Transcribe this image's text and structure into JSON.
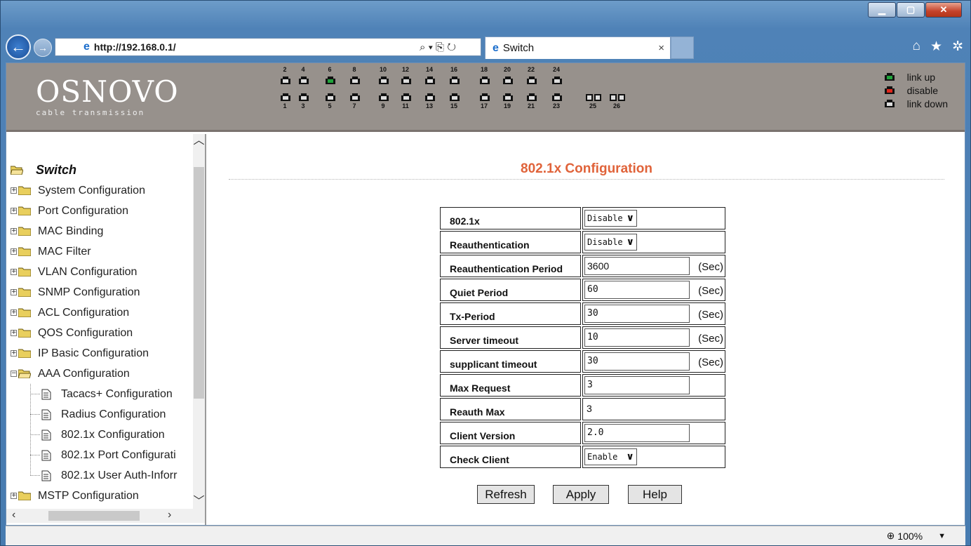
{
  "browser": {
    "url": "http://192.168.0.1/",
    "tab_title": "Switch",
    "tab_close": "×",
    "addr_tools": "⌕ ▾ ⎘ ↻",
    "zoom": "100%"
  },
  "banner": {
    "logo_name": "OSNOVO",
    "logo_tagline": "cable transmission",
    "ports_top": [
      "2",
      "4",
      "6",
      "8",
      "10",
      "12",
      "14",
      "16",
      "18",
      "20",
      "22",
      "24"
    ],
    "ports_bottom": [
      "1",
      "3",
      "5",
      "7",
      "9",
      "11",
      "13",
      "15",
      "17",
      "19",
      "21",
      "23",
      "25",
      "26"
    ],
    "port_6_status": "link up",
    "legend": {
      "link_up": "link up",
      "disable": "disable",
      "link_down": "link down"
    },
    "colors": {
      "link_up": "#1fa33b",
      "disable": "#e0261b",
      "link_down": "#111111"
    }
  },
  "sidebar": {
    "root": "Switch",
    "items": [
      "System Configuration",
      "Port Configuration",
      "MAC Binding",
      "MAC Filter",
      "VLAN Configuration",
      "SNMP Configuration",
      "ACL Configuration",
      "QOS Configuration",
      "IP Basic Configuration",
      "AAA Configuration"
    ],
    "aaa_children": [
      "Tacacs+ Configuration",
      "Radius Configuration",
      "802.1x Configuration",
      "802.1x Port Configurati",
      "802.1x User Auth-Inforr"
    ],
    "after": "MSTP Configuration"
  },
  "main": {
    "title": "802.1x Configuration",
    "title_color": "#e0633a",
    "rows": {
      "dot1x": {
        "label": "802.1x",
        "value": "Disable"
      },
      "reauth": {
        "label": "Reauthentication",
        "value": "Disable"
      },
      "reauth_period": {
        "label": "Reauthentication Period",
        "value": "3600",
        "unit": "(Sec)"
      },
      "quiet_period": {
        "label": "Quiet Period",
        "value": "60",
        "unit": "(Sec)"
      },
      "tx_period": {
        "label": "Tx-Period",
        "value": "30",
        "unit": "(Sec)"
      },
      "server_timeout": {
        "label": "Server timeout",
        "value": "10",
        "unit": "(Sec)"
      },
      "supplicant_timeout": {
        "label": "supplicant timeout",
        "value": "30",
        "unit": "(Sec)"
      },
      "max_request": {
        "label": "Max Request",
        "value": "3"
      },
      "reauth_max": {
        "label": "Reauth Max",
        "value": "3"
      },
      "client_version": {
        "label": "Client Version",
        "value": "2.0"
      },
      "check_client": {
        "label": "Check Client",
        "value": "Enable"
      }
    },
    "buttons": {
      "refresh": "Refresh",
      "apply": "Apply",
      "help": "Help"
    }
  }
}
